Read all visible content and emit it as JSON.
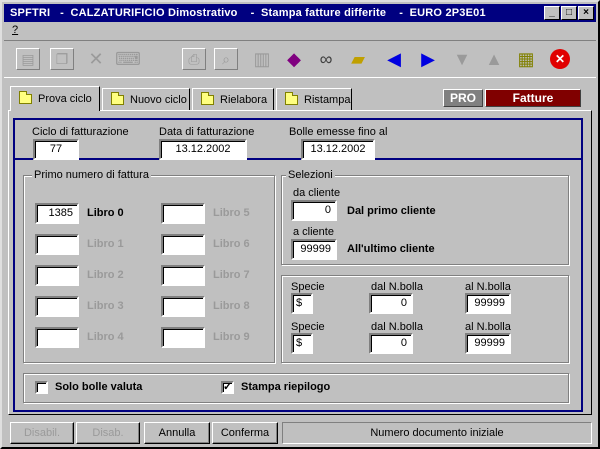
{
  "window": {
    "title": "SPFTRI   -  CALZATURIFICIO Dimostrativo    -  Stampa fatture differite    -  EURO 2P3E01",
    "minimize": "_",
    "restore": "□",
    "close": "×"
  },
  "menu": {
    "help": "?"
  },
  "toolbar": {
    "icons": [
      "new-doc-icon",
      "copy-doc-icon",
      "delete-icon",
      "keyboard-icon",
      "print-icon",
      "search-doc-icon",
      "printer-icon",
      "book-icon",
      "binoculars-icon",
      "folder-edit-icon",
      "arrow-left-icon",
      "arrow-right-icon",
      "arrow-down-icon",
      "arrow-up-icon",
      "calculator-icon",
      "close-circle-icon"
    ]
  },
  "tabs": [
    "Prova ciclo",
    "Nuovo ciclo",
    "Rielabora",
    "Ristampa"
  ],
  "badges": {
    "pro": "PRO",
    "fatture": "Fatture"
  },
  "header": {
    "ciclo_label": "Ciclo di fatturazione",
    "ciclo_value": "77",
    "data_label": "Data di fatturazione",
    "data_value": "13.12.2002",
    "bolle_label": "Bolle emesse fino al",
    "bolle_value": "13.12.2002"
  },
  "primo_numero": {
    "caption": "Primo numero di fattura",
    "libri": [
      {
        "value": "1385",
        "label": "Libro 0",
        "enabled": true
      },
      {
        "value": "",
        "label": "Libro 1",
        "enabled": false
      },
      {
        "value": "",
        "label": "Libro 2",
        "enabled": false
      },
      {
        "value": "",
        "label": "Libro 3",
        "enabled": false
      },
      {
        "value": "",
        "label": "Libro 4",
        "enabled": false
      },
      {
        "value": "",
        "label": "Libro 5",
        "enabled": false
      },
      {
        "value": "",
        "label": "Libro 6",
        "enabled": false
      },
      {
        "value": "",
        "label": "Libro 7",
        "enabled": false
      },
      {
        "value": "",
        "label": "Libro 8",
        "enabled": false
      },
      {
        "value": "",
        "label": "Libro 9",
        "enabled": false
      }
    ]
  },
  "selezioni": {
    "caption": "Selezioni",
    "da_cliente_label": "da cliente",
    "da_cliente_value": "0",
    "da_cliente_desc": "Dal primo cliente",
    "a_cliente_label": "a cliente",
    "a_cliente_value": "99999",
    "a_cliente_desc": "All'ultimo cliente"
  },
  "specie": {
    "rows": [
      {
        "specie_label": "Specie",
        "specie_value": "$",
        "dal_label": "dal N.bolla",
        "dal_value": "0",
        "al_label": "al N.bolla",
        "al_value": "99999"
      },
      {
        "specie_label": "Specie",
        "specie_value": "$",
        "dal_label": "dal N.bolla",
        "dal_value": "0",
        "al_label": "al N.bolla",
        "al_value": "99999"
      }
    ]
  },
  "options": {
    "solo_bolle_label": "Solo bolle valuta",
    "solo_bolle_checked": false,
    "stampa_riepilogo_label": "Stampa riepilogo",
    "stampa_riepilogo_checked": true,
    "check_mark": "✓"
  },
  "buttons": {
    "disabil": "Disabil.",
    "disab": "Disab.",
    "annulla": "Annulla",
    "conferma": "Conferma",
    "status": "Numero documento iniziale"
  }
}
